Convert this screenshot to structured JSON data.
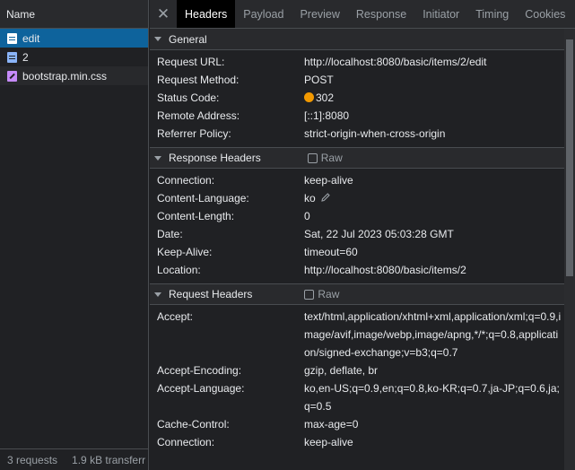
{
  "left_panel": {
    "header": "Name",
    "requests": [
      {
        "name": "edit",
        "type": "doc",
        "selected": true
      },
      {
        "name": "2",
        "type": "doc",
        "selected": false
      },
      {
        "name": "bootstrap.min.css",
        "type": "css",
        "selected": false
      }
    ],
    "footer": {
      "requests": "3 requests",
      "transferred": "1.9 kB transferr"
    }
  },
  "tabs": [
    "Headers",
    "Payload",
    "Preview",
    "Response",
    "Initiator",
    "Timing",
    "Cookies"
  ],
  "active_tab": "Headers",
  "sections": {
    "general": {
      "title": "General",
      "rows": [
        {
          "key": "Request URL:",
          "value": "http://localhost:8080/basic/items/2/edit"
        },
        {
          "key": "Request Method:",
          "value": "POST"
        },
        {
          "key": "Status Code:",
          "value": "302"
        },
        {
          "key": "Remote Address:",
          "value": "[::1]:8080"
        },
        {
          "key": "Referrer Policy:",
          "value": "strict-origin-when-cross-origin"
        }
      ]
    },
    "response": {
      "title": "Response Headers",
      "raw_label": "Raw",
      "rows": [
        {
          "key": "Connection:",
          "value": "keep-alive"
        },
        {
          "key": "Content-Language:",
          "value": "ko"
        },
        {
          "key": "Content-Length:",
          "value": "0"
        },
        {
          "key": "Date:",
          "value": "Sat, 22 Jul 2023 05:03:28 GMT"
        },
        {
          "key": "Keep-Alive:",
          "value": "timeout=60"
        },
        {
          "key": "Location:",
          "value": "http://localhost:8080/basic/items/2"
        }
      ]
    },
    "request": {
      "title": "Request Headers",
      "raw_label": "Raw",
      "rows": [
        {
          "key": "Accept:",
          "value": "text/html,application/xhtml+xml,application/xml;q=0.9,image/avif,image/webp,image/apng,*/*;q=0.8,application/signed-exchange;v=b3;q=0.7"
        },
        {
          "key": "Accept-Encoding:",
          "value": "gzip, deflate, br"
        },
        {
          "key": "Accept-Language:",
          "value": "ko,en-US;q=0.9,en;q=0.8,ko-KR;q=0.7,ja-JP;q=0.6,ja;q=0.5"
        },
        {
          "key": "Cache-Control:",
          "value": "max-age=0"
        },
        {
          "key": "Connection:",
          "value": "keep-alive"
        }
      ]
    }
  },
  "colors": {
    "status_dot": "#f29900",
    "selected_row": "#0e639c"
  }
}
